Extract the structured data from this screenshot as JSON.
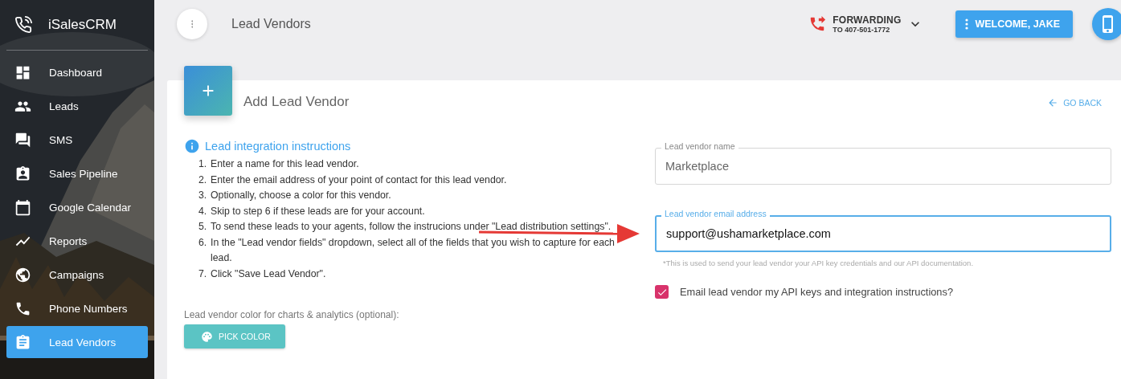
{
  "sidebar": {
    "brand": "iSalesCRM",
    "items": [
      {
        "label": "Dashboard",
        "selected": false
      },
      {
        "label": "Leads",
        "selected": false
      },
      {
        "label": "SMS",
        "selected": false
      },
      {
        "label": "Sales Pipeline",
        "selected": false
      },
      {
        "label": "Google Calendar",
        "selected": false
      },
      {
        "label": "Reports",
        "selected": false
      },
      {
        "label": "Campaigns",
        "selected": false
      },
      {
        "label": "Phone Numbers",
        "selected": false
      },
      {
        "label": "Lead Vendors",
        "selected": true
      }
    ]
  },
  "topbar": {
    "title": "Lead Vendors",
    "forwarding": {
      "label": "FORWARDING",
      "number": "TO 407-501-1772"
    },
    "user_button": "WELCOME, JAKE"
  },
  "card": {
    "title": "Add Lead Vendor",
    "back_link": "GO BACK",
    "instructions": {
      "title": "Lead integration instructions",
      "steps": [
        {
          "number": "1.",
          "text": "Enter a name for this lead vendor."
        },
        {
          "number": "2.",
          "text": "Enter the email address of your point of contact for this lead vendor."
        },
        {
          "number": "3.",
          "text": "Optionally, choose a color for this vendor."
        },
        {
          "number": "4.",
          "text": "Skip to step 6 if these leads are for your account."
        },
        {
          "number": "5.",
          "text": "To send these leads to your agents, follow the instrucions under \"Lead distribution settings\"."
        },
        {
          "number": "6.",
          "text": "In the \"Lead vendor fields\" dropdown, select all of the fields that you wish to capture for each lead."
        },
        {
          "number": "7.",
          "text": "Click \"Save Lead Vendor\"."
        }
      ]
    },
    "color_label": "Lead vendor color for charts & analytics (optional):",
    "color_button": "PICK COLOR",
    "fields": [
      {
        "label": "Lead vendor name",
        "value": "Marketplace",
        "focused": false
      },
      {
        "label": "Lead vendor email address",
        "value": "support@ushamarketplace.com",
        "focused": true,
        "helper": "*This is used to send your lead vendor your API key credentials and our API documentation."
      }
    ],
    "email_checkbox": {
      "label": "Email lead vendor my API keys and integration instructions?",
      "checked": true
    }
  }
}
